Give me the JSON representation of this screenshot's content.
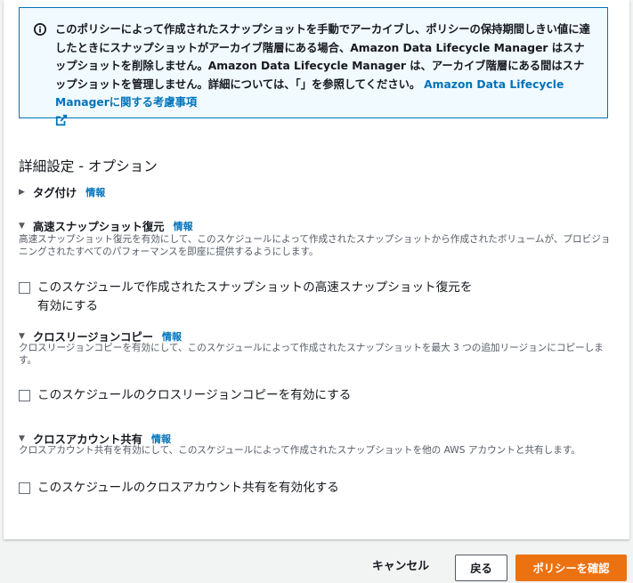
{
  "info_box": {
    "text": "このポリシーによって作成されたスナップショットを手動でアーカイブし、ポリシーの保持期間しきい値に達したときにスナップショットがアーカイブ階層にある場合、Amazon Data Lifecycle Manager はスナップショットを削除しません。Amazon Data Lifecycle Manager は、アーカイブ階層にある間はスナップショットを管理しません。詳細については、「」を参照してください。",
    "link_text": "Amazon Data Lifecycle Managerに関する考慮事項"
  },
  "advanced": {
    "title": "詳細設定 - オプション"
  },
  "tagging": {
    "label": "タグ付け",
    "info": "情報",
    "caret": "▶"
  },
  "fast_restore": {
    "label": "高速スナップショット復元",
    "info": "情報",
    "caret": "▼",
    "description": "高速スナップショット復元を有効にして、このスケジュールによって作成されたスナップショットから作成されたボリュームが、プロビジョニングされたすべてのパフォーマンスを即座に提供するようにします。",
    "checkbox_label": "このスケジュールで作成されたスナップショットの高速スナップショット復元を有効にする",
    "checked": false
  },
  "cross_region": {
    "label": "クロスリージョンコピー",
    "info": "情報",
    "caret": "▼",
    "description": "クロスリージョンコピーを有効にして、このスケジュールによって作成されたスナップショットを最大 3 つの追加リージョンにコピーします。",
    "checkbox_label": "このスケジュールのクロスリージョンコピーを有効にする",
    "checked": false
  },
  "cross_account": {
    "label": "クロスアカウント共有",
    "info": "情報",
    "caret": "▼",
    "description": "クロスアカウント共有を有効にして、このスケジュールによって作成されたスナップショットを他の AWS アカウントと共有します。",
    "checkbox_label": "このスケジュールのクロスアカウント共有を有効化する",
    "checked": false
  },
  "footer": {
    "cancel": "キャンセル",
    "back": "戻る",
    "confirm": "ポリシーを確認"
  },
  "colors": {
    "link": "#0073bb",
    "primary": "#ec7211",
    "info_bg": "#f1faff"
  }
}
